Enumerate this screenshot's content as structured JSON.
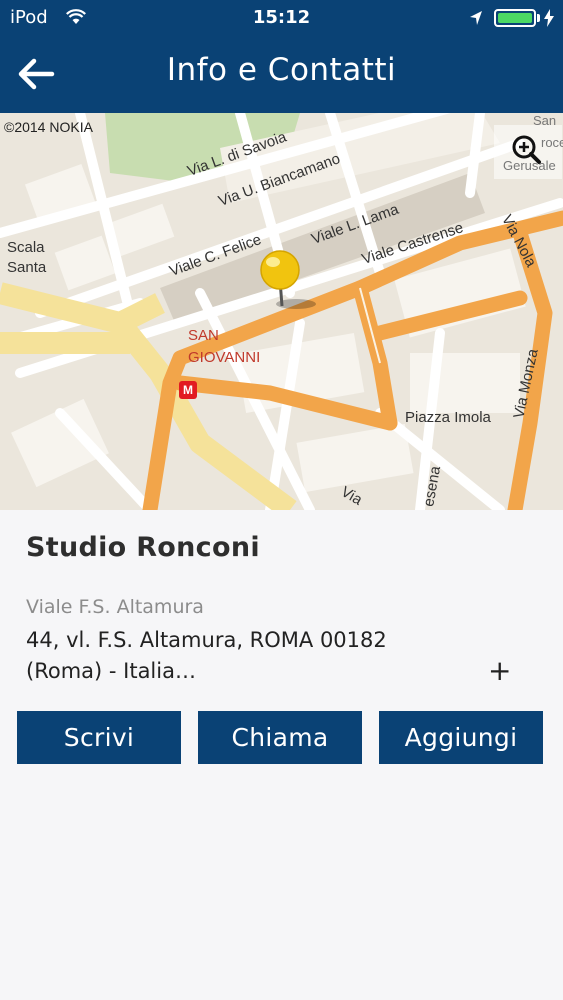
{
  "status_bar": {
    "carrier": "iPod",
    "time": "15:12",
    "battery_level": 1.0,
    "battery_color": "#4cd964"
  },
  "nav": {
    "title": "Info e Contatti",
    "back_icon": "arrow-left-icon"
  },
  "map": {
    "copyright": "©2014 NOKIA",
    "zoom_icon": "zoom-in-icon",
    "pin_icon": "map-pin-icon",
    "metro_badge": "M",
    "labels": {
      "via_savoia": "Via L. di Savoia",
      "via_biancamano": "Via U. Biancamano",
      "viale_lama": "Viale L. Lama",
      "viale_felice": "Viale C. Felice",
      "viale_castrense": "Viale Castrense",
      "via_nola": "Via Nola",
      "via_monza": "Via Monza",
      "scala": "Scala",
      "santa": "Santa",
      "san": "SAN",
      "giovanni": "GIOVANNI",
      "piazza_imola": "Piazza Imola",
      "via_bottom": "Via",
      "esena": "esena",
      "gerusale": "Gerusale",
      "san_right": "San",
      "croce": "roce"
    }
  },
  "contact": {
    "name": "Studio Ronconi",
    "address_street": "Viale F.S. Altamura",
    "address_line1": "44, vl. F.S. Altamura, ROMA 00182",
    "address_line2": "(Roma) - Italia…",
    "expand_label": "+"
  },
  "actions": {
    "write": "Scrivi",
    "call": "Chiama",
    "add": "Aggiungi"
  },
  "colors": {
    "brand": "#0a4275",
    "road_major": "#f2a54a",
    "road_yellow": "#f5e29a",
    "park": "#c8ddb0"
  }
}
